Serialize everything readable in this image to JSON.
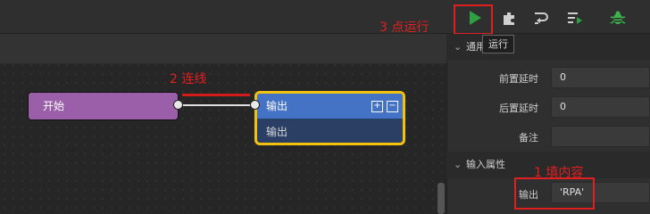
{
  "toolbar": {
    "run_tooltip": "运行",
    "colors": {
      "run": "#2ea043",
      "debug": "#3cb44b",
      "tool": "#cfcfcf"
    },
    "icons": [
      "play-icon",
      "plugin-icon",
      "step-over-icon",
      "list-run-icon",
      "bug-icon"
    ]
  },
  "canvas": {
    "start_node": {
      "label": "开始",
      "color": "#9b5ea8"
    },
    "output_node": {
      "title": "输出",
      "field": "输出",
      "header_color": "#4472c4",
      "highlight_color": "#f2c20f"
    }
  },
  "annotations": {
    "step1": "1 填内容",
    "step2": "2 连线",
    "step3": "3 点运行"
  },
  "panel": {
    "general_section": "通用",
    "props": [
      {
        "label": "前置延时",
        "value": "0"
      },
      {
        "label": "后置延时",
        "value": "0"
      },
      {
        "label": "备注",
        "value": ""
      }
    ],
    "input_section": "输入属性",
    "input_props": [
      {
        "label": "输出",
        "value": "'RPA'"
      }
    ]
  }
}
